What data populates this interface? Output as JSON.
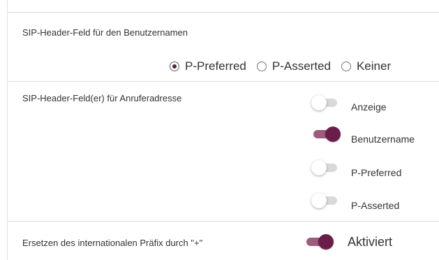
{
  "username_header": {
    "label": "SIP-Header-Feld für den Benutzernamen",
    "options": [
      {
        "label": "P-Preferred",
        "selected": true
      },
      {
        "label": "P-Asserted",
        "selected": false
      },
      {
        "label": "Keiner",
        "selected": false
      }
    ]
  },
  "caller_address": {
    "label": "SIP-Header-Feld(er) für Anruferadresse",
    "toggles": [
      {
        "label": "Anzeige",
        "on": false
      },
      {
        "label": "Benutzername",
        "on": true
      },
      {
        "label": "P-Preferred",
        "on": false
      },
      {
        "label": "P-Asserted",
        "on": false
      }
    ]
  },
  "intl_prefix": {
    "label": "Ersetzen des internationalen Präfix durch \"+\"",
    "toggle_label": "Aktiviert",
    "on": true
  },
  "colors": {
    "accent": "#6b1d4a",
    "accent_track": "#9c5c7e",
    "off_track": "#d9d9d9"
  }
}
